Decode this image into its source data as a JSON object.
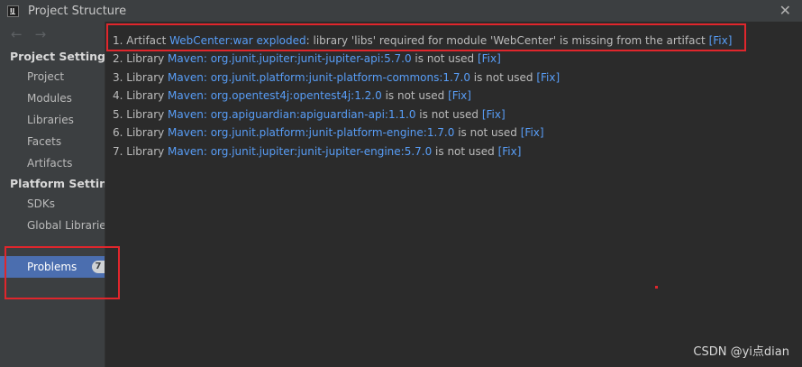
{
  "window": {
    "title": "Project Structure",
    "close_symbol": "✕"
  },
  "nav": {
    "back_symbol": "←",
    "forward_symbol": "→"
  },
  "sidebar": {
    "project_settings_header": "Project Settings",
    "project_items": [
      "Project",
      "Modules",
      "Libraries",
      "Facets",
      "Artifacts"
    ],
    "platform_settings_header": "Platform Settings",
    "platform_items": [
      "SDKs",
      "Global Libraries"
    ],
    "problems": {
      "label": "Problems",
      "count": "7"
    }
  },
  "problems": [
    {
      "prefix": "1. Artifact ",
      "link": "WebCenter:war exploded",
      "message": ": library 'libs' required for module 'WebCenter' is missing from the artifact ",
      "fix": "[Fix]"
    },
    {
      "prefix": "2. Library ",
      "link": "Maven: org.junit.jupiter:junit-jupiter-api:5.7.0",
      "message": " is not used ",
      "fix": "[Fix]"
    },
    {
      "prefix": "3. Library ",
      "link": "Maven: org.junit.platform:junit-platform-commons:1.7.0",
      "message": " is not used ",
      "fix": "[Fix]"
    },
    {
      "prefix": "4. Library ",
      "link": "Maven: org.opentest4j:opentest4j:1.2.0",
      "message": " is not used ",
      "fix": "[Fix]"
    },
    {
      "prefix": "5. Library ",
      "link": "Maven: org.apiguardian:apiguardian-api:1.1.0",
      "message": " is not used ",
      "fix": "[Fix]"
    },
    {
      "prefix": "6. Library ",
      "link": "Maven: org.junit.platform:junit-platform-engine:1.7.0",
      "message": " is not used ",
      "fix": "[Fix]"
    },
    {
      "prefix": "7. Library ",
      "link": "Maven: org.junit.jupiter:junit-jupiter-engine:5.7.0",
      "message": " is not used ",
      "fix": "[Fix]"
    }
  ],
  "watermark": "CSDN @yi点dian",
  "colors": {
    "link": "#589df6",
    "selection": "#4b6eaf",
    "highlight_box": "#e0262c"
  }
}
